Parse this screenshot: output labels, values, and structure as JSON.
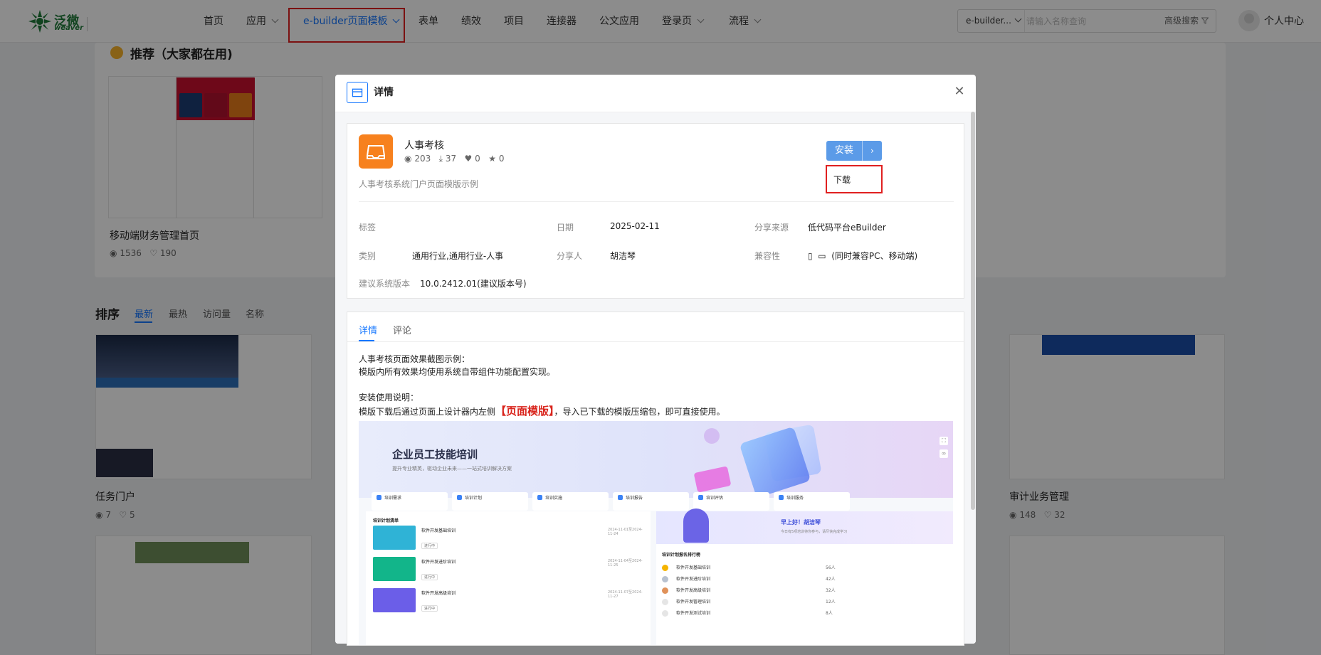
{
  "brand": {
    "name_cn": "泛微",
    "name_en": "weaver"
  },
  "nav": [
    {
      "label": "首页"
    },
    {
      "label": "应用"
    },
    {
      "label": "e-builder页面模板"
    },
    {
      "label": "表单"
    },
    {
      "label": "绩效"
    },
    {
      "label": "项目"
    },
    {
      "label": "连接器"
    },
    {
      "label": "公文应用"
    },
    {
      "label": "登录页"
    },
    {
      "label": "流程"
    }
  ],
  "search": {
    "scope": "e-builder...",
    "placeholder": "请输入名称查询",
    "advanced": "高级搜索"
  },
  "user": {
    "label": "个人中心"
  },
  "recommend": {
    "title": "推荐（大家都在用)",
    "items": [
      {
        "name": "移动端财务管理首页",
        "views": "1536",
        "likes": "190"
      }
    ]
  },
  "sort": {
    "label": "排序",
    "tabs": [
      "最新",
      "最热",
      "访问量",
      "名称"
    ]
  },
  "cards": [
    {
      "name": "任务门户",
      "views": "7",
      "likes": "5"
    },
    {
      "name": "审计业务管理",
      "views": "148",
      "likes": "32"
    }
  ],
  "modal": {
    "title": "详情",
    "app_name": "人事考核",
    "stats": {
      "views": "203",
      "downloads": "37",
      "likes": "0",
      "stars": "0"
    },
    "description": "人事考核系统门户页面模版示例",
    "install_label": "安装",
    "dropdown_item": "下载",
    "fields": {
      "tags_label": "标签",
      "date_label": "日期",
      "date_value": "2025-02-11",
      "source_label": "分享来源",
      "source_value": "低代码平台eBuilder",
      "category_label": "类别",
      "category_value": "通用行业,通用行业-人事",
      "sharer_label": "分享人",
      "sharer_value": "胡洁琴",
      "compat_label": "兼容性",
      "compat_value": "(同时兼容PC、移动端)",
      "version_label": "建议系统版本",
      "version_value": "10.0.2412.01(建议版本号)"
    },
    "tabs": [
      "详情",
      "评论"
    ],
    "detail": {
      "line1": "人事考核页面效果截图示例：",
      "line2": "模版内所有效果均使用系统自带组件功能配置实现。",
      "line3": "安装使用说明：",
      "line4_pre": "模版下载后通过页面上设计器内左侧",
      "line4_em": "【页面模版】",
      "line4_post": "，导入已下载的模版压缩包，即可直接使用。"
    },
    "banner": {
      "title": "企业员工技能培训",
      "subtitle": "提升专业精英，驱动企业未来——一站式培训解决方案",
      "cards": [
        "培训需求",
        "培训计划",
        "培训实施",
        "培训报告",
        "培训评估",
        "培训服务"
      ],
      "list_title": "培训计划清单",
      "rows": [
        {
          "title": "软件开发基础培训",
          "time": "2024-11-01至2024-11-24",
          "tag": "进行中"
        },
        {
          "title": "软件开发进阶培训",
          "time": "2024-11-04至2024-11-25",
          "tag": "进行中"
        },
        {
          "title": "软件开发高级培训",
          "time": "2024-11-07至2024-11-27",
          "tag": "进行中"
        }
      ],
      "greeting": "早上好！胡洁琴",
      "greeting_sub": "今日有5项培训待你参与，请尽快完成学习",
      "rank_title": "培训计划报名排行榜",
      "ranks": [
        {
          "name": "软件开发基础培训",
          "count": "56人"
        },
        {
          "name": "软件开发进阶培训",
          "count": "42人"
        },
        {
          "name": "软件开发高级培训",
          "count": "32人"
        },
        {
          "name": "软件开发管理培训",
          "count": "12人"
        },
        {
          "name": "软件开发测试培训",
          "count": "8人"
        }
      ]
    }
  }
}
